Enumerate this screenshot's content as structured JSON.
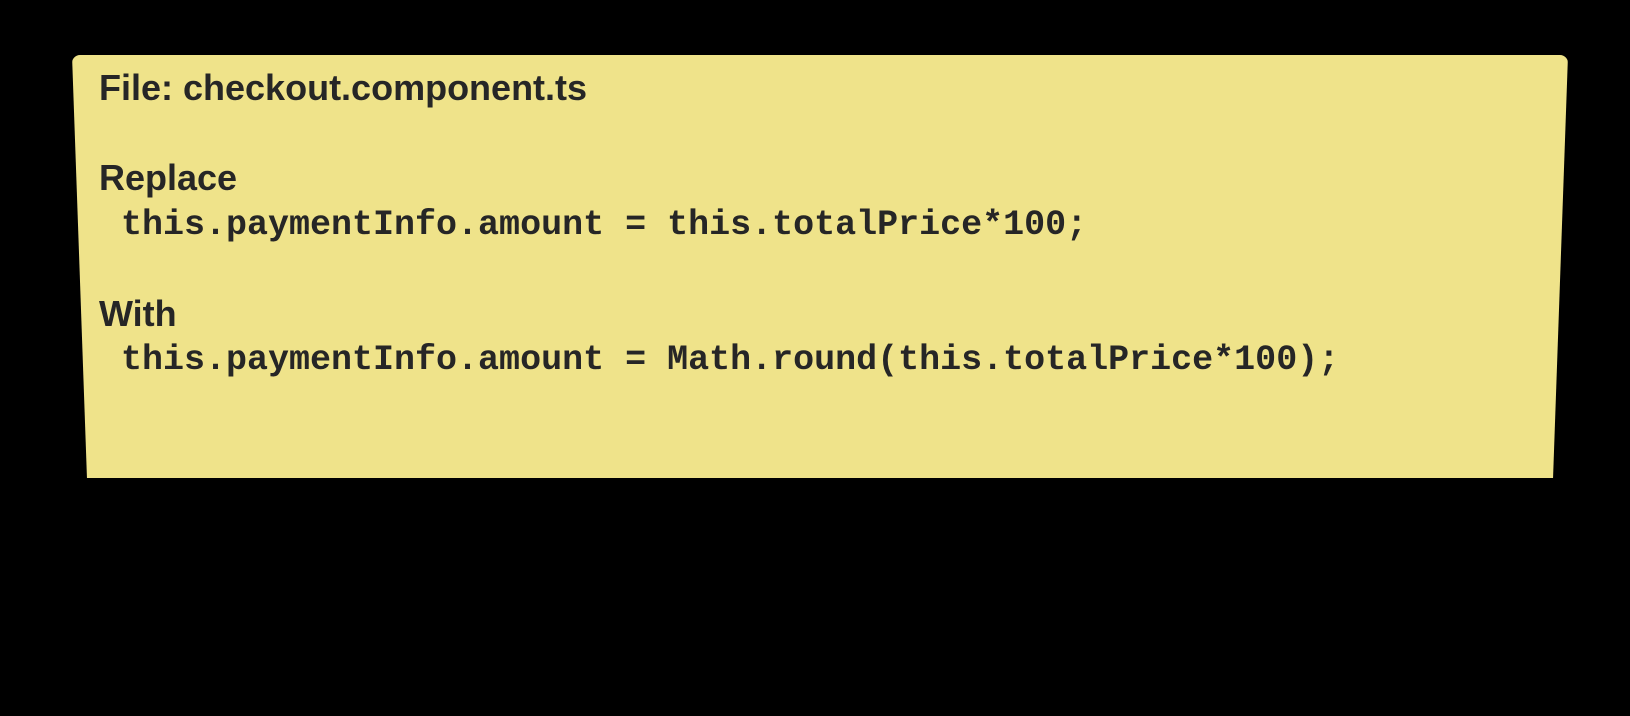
{
  "note": {
    "background_color": "#efe38a",
    "text_color": "#262626",
    "file_line": "File: checkout.component.ts",
    "replace_label": "Replace",
    "old_code": "this.paymentInfo.amount = this.totalPrice*100;",
    "with_label": "With",
    "new_code": "this.paymentInfo.amount = Math.round(this.totalPrice*100);"
  }
}
